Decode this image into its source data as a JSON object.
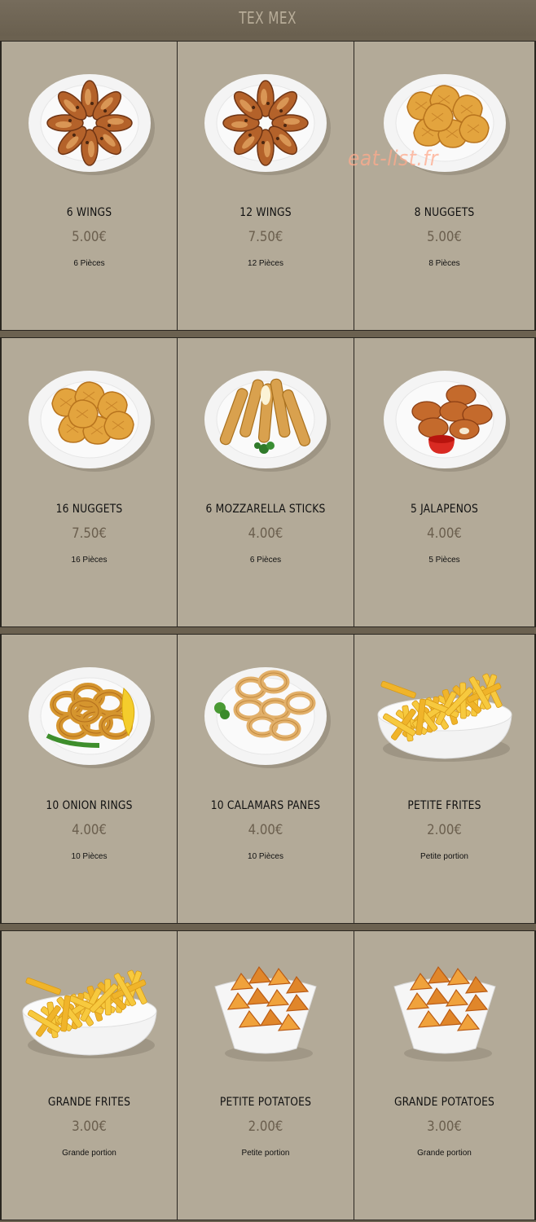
{
  "header": {
    "title": "TEX MEX"
  },
  "watermark": "eat-list.fr",
  "items": [
    {
      "name": "6 WINGS",
      "price": "5.00€",
      "desc": "6 Pièces",
      "image": "wings-plate"
    },
    {
      "name": "12 WINGS",
      "price": "7.50€",
      "desc": "12 Pièces",
      "image": "wings-plate"
    },
    {
      "name": "8 NUGGETS",
      "price": "5.00€",
      "desc": "8 Pièces",
      "image": "nuggets-plate"
    },
    {
      "name": "16 NUGGETS",
      "price": "7.50€",
      "desc": "16 Pièces",
      "image": "nuggets-plate"
    },
    {
      "name": "6 MOZZARELLA STICKS",
      "price": "4.00€",
      "desc": "6 Pièces",
      "image": "mozzarella-sticks-plate"
    },
    {
      "name": "5 JALAPENOS",
      "price": "4.00€",
      "desc": "5 Pièces",
      "image": "jalapenos-plate"
    },
    {
      "name": "10 ONION RINGS",
      "price": "4.00€",
      "desc": "10 Pièces",
      "image": "onion-rings-plate"
    },
    {
      "name": "10 CALAMARS PANES",
      "price": "4.00€",
      "desc": "10 Pièces",
      "image": "calamari-plate"
    },
    {
      "name": "PETITE FRITES",
      "price": "2.00€",
      "desc": "Petite portion",
      "image": "fries-bowl"
    },
    {
      "name": "GRANDE FRITES",
      "price": "3.00€",
      "desc": "Grande portion",
      "image": "fries-bowl"
    },
    {
      "name": "PETITE POTATOES",
      "price": "2.00€",
      "desc": "Petite portion",
      "image": "potatoes-bowl"
    },
    {
      "name": "GRANDE POTATOES",
      "price": "3.00€",
      "desc": "Grande portion",
      "image": "potatoes-bowl"
    }
  ]
}
